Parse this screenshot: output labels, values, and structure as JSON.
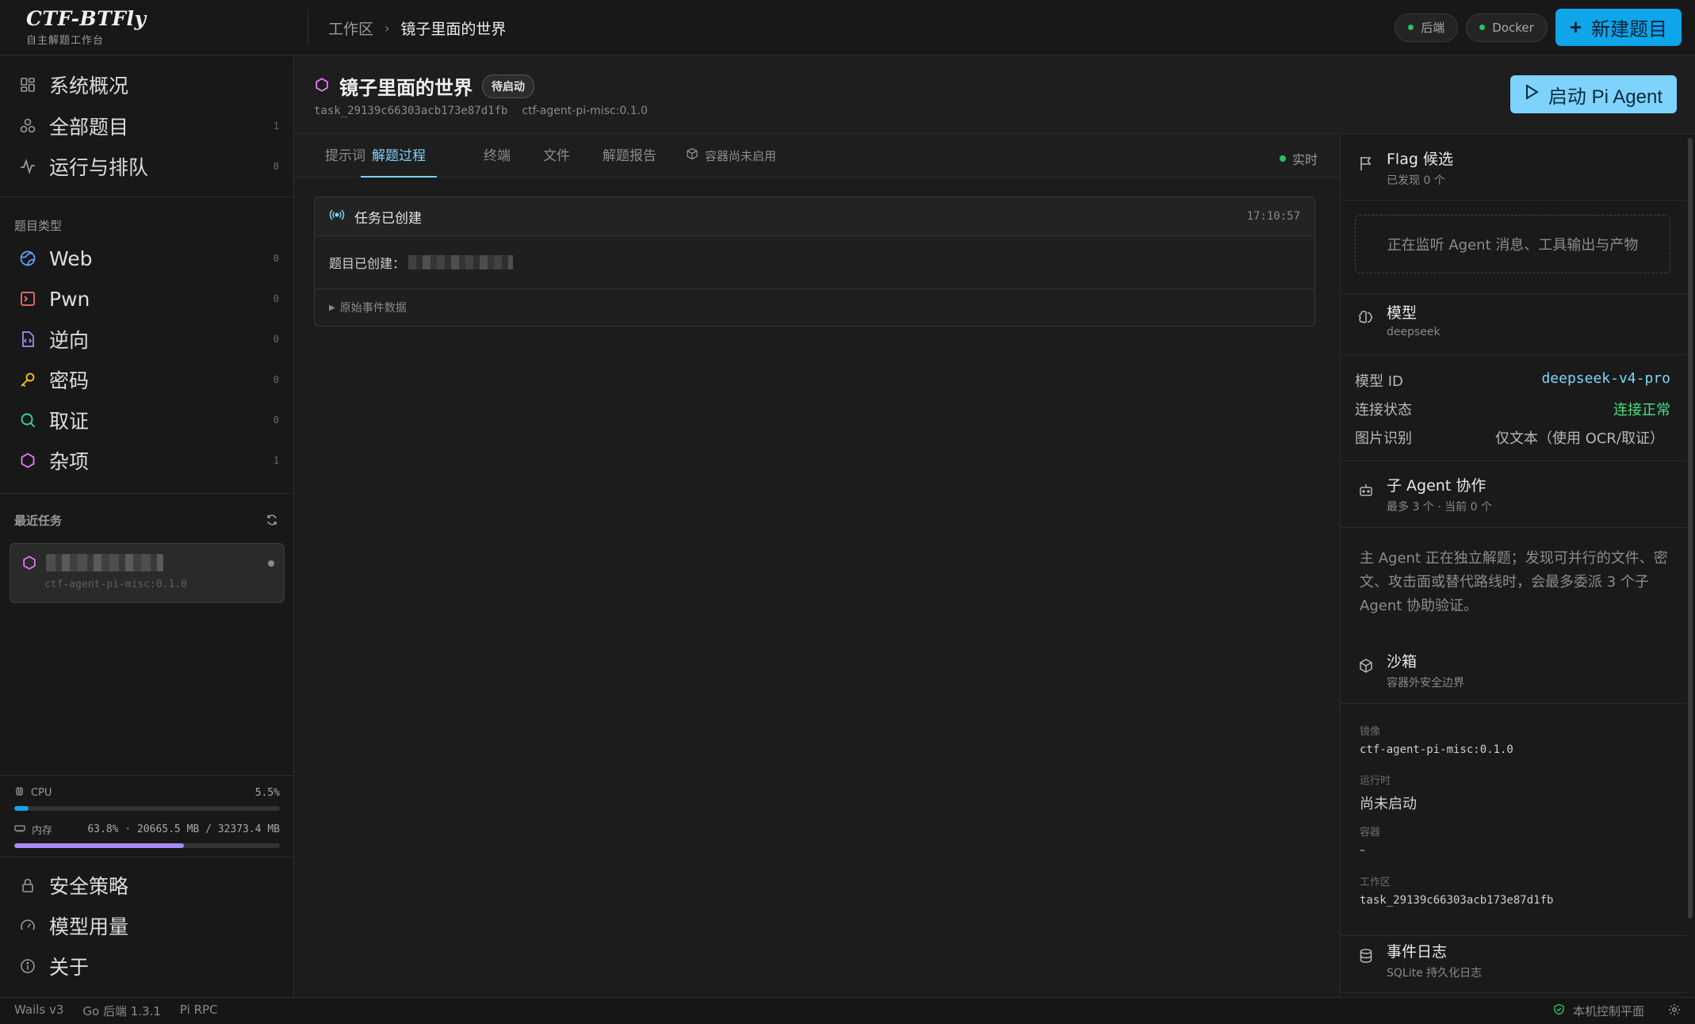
{
  "brand": {
    "title": "CTF-BTFly",
    "subtitle": "自主解题工作台"
  },
  "breadcrumb": {
    "root": "工作区",
    "current": "镜子里面的世界"
  },
  "topbar": {
    "backend_label": "后端",
    "docker_label": "Docker",
    "new_task_label": "新建题目",
    "status_color": "#22c55e",
    "accent": "#0ea5e9"
  },
  "sidebar": {
    "nav": [
      {
        "label": "系统概况",
        "count": "",
        "icon": "dashboard-icon"
      },
      {
        "label": "全部题目",
        "count": "1",
        "icon": "tasks-icon"
      },
      {
        "label": "运行与排队",
        "count": "0",
        "icon": "activity-icon"
      }
    ],
    "categories_title": "题目类型",
    "categories": [
      {
        "label": "Web",
        "count": "0",
        "icon": "globe-icon",
        "color": "#60a5fa"
      },
      {
        "label": "Pwn",
        "count": "0",
        "icon": "terminal-icon",
        "color": "#f87171"
      },
      {
        "label": "逆向",
        "count": "0",
        "icon": "code-file-icon",
        "color": "#a78bfa"
      },
      {
        "label": "密码",
        "count": "0",
        "icon": "key-icon",
        "color": "#facc15"
      },
      {
        "label": "取证",
        "count": "0",
        "icon": "search-icon",
        "color": "#34d399"
      },
      {
        "label": "杂项",
        "count": "1",
        "icon": "hexagon-icon",
        "color": "#e879f9"
      }
    ],
    "recent_title": "最近任务",
    "recent_task": {
      "image": "ctf-agent-pi-misc:0.1.0"
    },
    "metrics": {
      "cpu_label": "CPU",
      "cpu_value": "5.5%",
      "cpu_fraction": 0.055,
      "mem_label": "内存",
      "mem_value": "63.8% · 20665.5 MB / 32373.4 MB",
      "mem_fraction": 0.638
    },
    "bottom_nav": [
      {
        "label": "安全策略",
        "icon": "lock-icon"
      },
      {
        "label": "模型用量",
        "icon": "gauge-icon"
      },
      {
        "label": "关于",
        "icon": "info-icon"
      }
    ]
  },
  "task": {
    "title": "镜子里面的世界",
    "status": "待启动",
    "id": "task_29139c66303acb173e87d1fb",
    "image": "ctf-agent-pi-misc:0.1.0",
    "start_label": "启动 Pi Agent"
  },
  "tabs": {
    "items": [
      "提示词",
      "解题过程",
      "终端",
      "文件",
      "解题报告",
      "容器尚未启用"
    ],
    "active_index": 1,
    "live_label": "实时"
  },
  "event": {
    "title": "任务已创建",
    "time": "17:10:57",
    "body": "题目已创建：",
    "raw_label": "原始事件数据"
  },
  "rpanel": {
    "flag_title": "Flag 候选",
    "flag_sub": "已发现 0 个",
    "listening": "正在监听 Agent 消息、工具输出与产物",
    "model_title": "模型",
    "model_sub": "deepseek",
    "model_id_label": "模型 ID",
    "model_id": "deepseek-v4-pro",
    "conn_label": "连接状态",
    "conn_value": "连接正常",
    "img_label": "图片识别",
    "img_value": "仅文本（使用 OCR/取证）",
    "sub_title": "子 Agent 协作",
    "sub_sub": "最多 3 个 · 当前 0 个",
    "sub_note": "主 Agent 正在独立解题；发现可并行的文件、密文、攻击面或替代路线时，会最多委派 3 个子 Agent 协助验证。",
    "sandbox_title": "沙箱",
    "sandbox_sub": "容器外安全边界",
    "image_label": "镜像",
    "image_value": "ctf-agent-pi-misc:0.1.0",
    "runtime_label": "运行时",
    "runtime_value": "尚未启动",
    "container_label": "容器",
    "container_value": "–",
    "workspace_label": "工作区",
    "workspace_value": "task_29139c66303acb173e87d1fb",
    "log_title": "事件日志",
    "log_sub": "SQLite 持久化日志"
  },
  "statusbar": {
    "wails": "Wails v3",
    "go": "Go 后端 1.3.1",
    "rpc": "Pi RPC",
    "control": "本机控制平面"
  }
}
